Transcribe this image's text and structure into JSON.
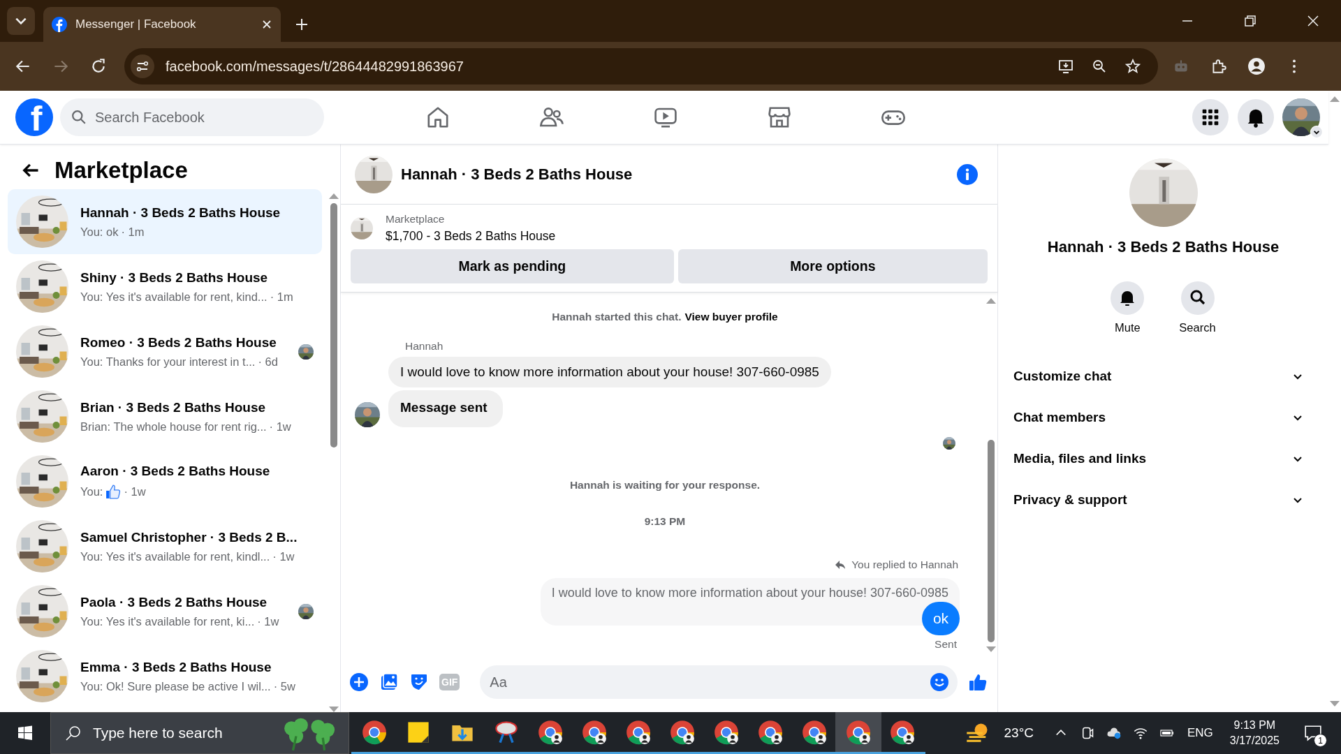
{
  "browser": {
    "tab_title": "Messenger | Facebook",
    "url": "facebook.com/messages/t/28644482991863967"
  },
  "header": {
    "logo_letter": "f",
    "search": {
      "placeholder": "Search Facebook"
    }
  },
  "sidebar": {
    "title": "Marketplace",
    "conversations": [
      {
        "name": "Hannah · 3 Beds 2 Baths House",
        "kind": "text",
        "preview": "You: ok",
        "time": "· 1m",
        "selected": true,
        "seen_avatar": false
      },
      {
        "name": "Shiny · 3 Beds 2 Baths House",
        "kind": "text",
        "preview": "You: Yes it's available for rent, kind...",
        "time": "· 1m",
        "selected": false,
        "seen_avatar": false
      },
      {
        "name": "Romeo · 3 Beds 2 Baths House",
        "kind": "text",
        "preview": "You: Thanks for your interest in t...",
        "time": "· 6d",
        "selected": false,
        "seen_avatar": true
      },
      {
        "name": "Brian · 3 Beds 2 Baths House",
        "kind": "text",
        "preview": "Brian: The whole house for rent rig...",
        "time": "· 1w",
        "selected": false,
        "seen_avatar": false
      },
      {
        "name": "Aaron · 3 Beds 2 Baths House",
        "kind": "like",
        "preview": "You:",
        "time": "· 1w",
        "selected": false,
        "seen_avatar": false
      },
      {
        "name": "Samuel Christopher · 3 Beds 2 B...",
        "kind": "text",
        "preview": "You: Yes it's available for rent, kindl...",
        "time": "· 1w",
        "selected": false,
        "seen_avatar": false
      },
      {
        "name": "Paola · 3 Beds 2 Baths House",
        "kind": "text",
        "preview": "You: Yes it's available for rent, ki...",
        "time": "· 1w",
        "selected": false,
        "seen_avatar": true
      },
      {
        "name": "Emma · 3 Beds 2 Baths House",
        "kind": "text",
        "preview": "You: Ok! Sure please be active I wil...",
        "time": "· 5w",
        "selected": false,
        "seen_avatar": false
      }
    ]
  },
  "chat": {
    "title": "Hannah · 3 Beds 2 Baths House",
    "listing": {
      "label": "Marketplace",
      "title": "$1,700 - 3 Beds 2 Baths House",
      "buttons": [
        "Mark as pending",
        "More options"
      ]
    },
    "messages": [
      {
        "kind": "notice",
        "text": "Hannah started this chat.",
        "link": "View buyer profile"
      },
      {
        "kind": "sender",
        "text": "Hannah"
      },
      {
        "kind": "incoming",
        "text": "I would love to know more information about your house! 307-660-0985",
        "avatar": false,
        "bold": false
      },
      {
        "kind": "incoming",
        "text": "Message sent",
        "avatar": true,
        "bold": true
      },
      {
        "kind": "read_receipt"
      },
      {
        "kind": "notice",
        "text": "Hannah is waiting for your response."
      },
      {
        "kind": "timestamp",
        "text": "9:13 PM"
      },
      {
        "kind": "reply_note",
        "text": "You replied to Hannah"
      },
      {
        "kind": "quoted",
        "text": "I would love to know more information about your house! 307-660-0985"
      },
      {
        "kind": "outgoing",
        "text": "ok"
      },
      {
        "kind": "status",
        "text": "Sent"
      }
    ],
    "composer": {
      "gif_label": "GIF",
      "placeholder": "Aa"
    }
  },
  "details": {
    "name": "Hannah · 3 Beds 2 Baths House",
    "actions": [
      {
        "kind": "bell",
        "label": "Mute"
      },
      {
        "kind": "search",
        "label": "Search"
      }
    ],
    "sections": [
      {
        "label": "Customize chat",
        "expanded": false
      },
      {
        "label": "Chat members",
        "expanded": false
      },
      {
        "label": "Media, files and links",
        "expanded": false
      },
      {
        "label": "Privacy & support",
        "expanded": false
      }
    ]
  },
  "taskbar": {
    "search_placeholder": "Type here to search",
    "apps": [
      {
        "kind": "browser",
        "selected": false
      },
      {
        "kind": "note",
        "selected": false
      },
      {
        "kind": "folder",
        "selected": false
      },
      {
        "kind": "tool",
        "selected": false
      },
      {
        "kind": "profile",
        "selected": false
      },
      {
        "kind": "profile",
        "selected": false
      },
      {
        "kind": "profile",
        "selected": false
      },
      {
        "kind": "profile",
        "selected": false
      },
      {
        "kind": "profile",
        "selected": false
      },
      {
        "kind": "profile",
        "selected": false
      },
      {
        "kind": "profile",
        "selected": false
      },
      {
        "kind": "profile",
        "selected": true
      },
      {
        "kind": "profile",
        "selected": false
      }
    ],
    "temperature": "23°C",
    "language": "ENG",
    "time": "9:13 PM",
    "date": "3/17/2025",
    "notifications": "1"
  }
}
